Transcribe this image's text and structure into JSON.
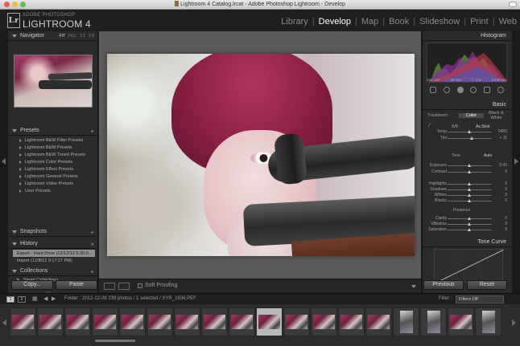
{
  "window": {
    "title": "Lightroom 4 Catalog.lrcat - Adobe Photoshop Lightroom - Develop"
  },
  "identity": {
    "logo": "Lr",
    "small": "ADOBE PHOTOSHOP",
    "big": "LIGHTROOM 4"
  },
  "modules": [
    {
      "label": "Library",
      "active": false
    },
    {
      "label": "Develop",
      "active": true
    },
    {
      "label": "Map",
      "active": false
    },
    {
      "label": "Book",
      "active": false
    },
    {
      "label": "Slideshow",
      "active": false
    },
    {
      "label": "Print",
      "active": false
    },
    {
      "label": "Web",
      "active": false
    }
  ],
  "navigator": {
    "title": "Navigator",
    "zoom": [
      "FIT",
      "FILL",
      "1:1",
      "1:8"
    ],
    "zoom_selected": "FIT"
  },
  "presets": {
    "title": "Presets",
    "items": [
      "Lightroom B&W Filter Presets",
      "Lightroom B&W Presets",
      "Lightroom B&W Toned Presets",
      "Lightroom Color Presets",
      "Lightroom Effect Presets",
      "Lightroom General Presets",
      "Lightroom Video Presets",
      "User Presets"
    ]
  },
  "snapshots": {
    "title": "Snapshots"
  },
  "history": {
    "title": "History",
    "items": [
      {
        "label": "Export - Hard Drive (12/12/12 5:30:0...",
        "selected": true
      },
      {
        "label": "Import (12/8/12 9:17:27 PM)",
        "selected": false
      }
    ]
  },
  "collections": {
    "title": "Collections",
    "items": [
      "Smart Collections"
    ]
  },
  "left_buttons": {
    "copy": "Copy...",
    "paste": "Paste"
  },
  "toolbar": {
    "soft_proofing": "Soft Proofing"
  },
  "histogram_panel": {
    "title": "Histogram",
    "info": [
      "ISO 100",
      "50 mm",
      "f / 2.8",
      "1/100 sec"
    ]
  },
  "basic": {
    "title": "Basic",
    "treatment_label": "Treatment :",
    "treatment_options": [
      {
        "label": "Color",
        "active": true
      },
      {
        "label": "Black & White",
        "active": false
      }
    ],
    "wb_label": "WB :",
    "wb_value": "As Shot",
    "tone_label": "Tone",
    "tone_auto": "Auto",
    "presence_label": "Presence",
    "sliders": [
      {
        "label": "Temp",
        "value": "5450",
        "pos": 0.5
      },
      {
        "label": "Tint",
        "value": "+ 11",
        "pos": 0.55
      },
      {
        "label": "Exposure",
        "value": "0.00",
        "pos": 0.5
      },
      {
        "label": "Contrast",
        "value": "0",
        "pos": 0.5
      },
      {
        "label": "Highlights",
        "value": "0",
        "pos": 0.5
      },
      {
        "label": "Shadows",
        "value": "0",
        "pos": 0.5
      },
      {
        "label": "Whites",
        "value": "0",
        "pos": 0.5
      },
      {
        "label": "Blacks",
        "value": "0",
        "pos": 0.5
      },
      {
        "label": "Clarity",
        "value": "0",
        "pos": 0.5
      },
      {
        "label": "Vibrance",
        "value": "0",
        "pos": 0.5
      },
      {
        "label": "Saturation",
        "value": "0",
        "pos": 0.5
      }
    ]
  },
  "tone_curve": {
    "title": "Tone Curve"
  },
  "right_buttons": {
    "previous": "Previous",
    "reset": "Reset"
  },
  "filmstrip": {
    "pages": [
      "1",
      "2"
    ],
    "source": "Folder : 2012-12-08     239 photos / 1 selected / XYR_1936.PEF",
    "filter_label": "Filter :",
    "filter_value": "Filters Off"
  }
}
